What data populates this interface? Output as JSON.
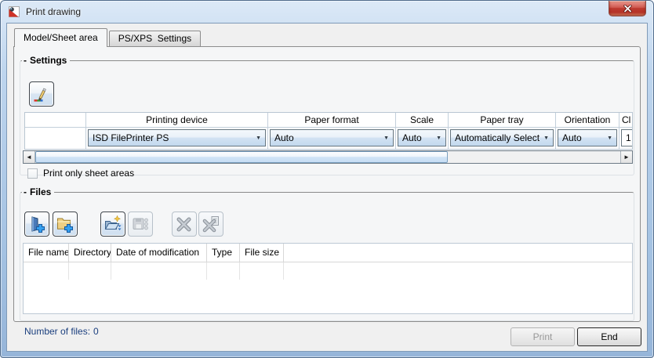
{
  "window": {
    "title": "Print drawing"
  },
  "tabs": [
    {
      "label": "Model/Sheet area",
      "active": true
    },
    {
      "label": "PS/XPS  Settings",
      "active": false
    }
  ],
  "settings": {
    "collapse_glyph": "-",
    "group_label": "Settings",
    "columns": [
      "",
      "Printing device",
      "Paper format",
      "Scale",
      "Paper tray",
      "Orientation",
      "Cl"
    ],
    "row": {
      "printing_device": "ISD FilePrinter PS",
      "paper_format": "Auto",
      "scale": "Auto",
      "paper_tray": "Automatically Select",
      "orientation": "Auto",
      "copies": "1"
    },
    "checkbox_label": "Print only sheet areas",
    "checkbox_checked": false
  },
  "files": {
    "collapse_glyph": "-",
    "group_label": "Files",
    "columns": [
      "File name",
      "Directory",
      "Date of modification",
      "Type",
      "File size"
    ],
    "rows": []
  },
  "footer": {
    "files_count_label": "Number of files:",
    "files_count_value": "0",
    "print_button_label": "Print",
    "end_button_label": "End"
  },
  "icons": {
    "combo_arrow": "▼",
    "scroll_left": "◄",
    "scroll_right": "►"
  },
  "colors": {
    "titlebar_blue": "#a9c6e6",
    "close_button_red": "#bd3a30",
    "files_count_navy": "#1b3f7e",
    "tab_page_bg": "#f5f6f7"
  }
}
